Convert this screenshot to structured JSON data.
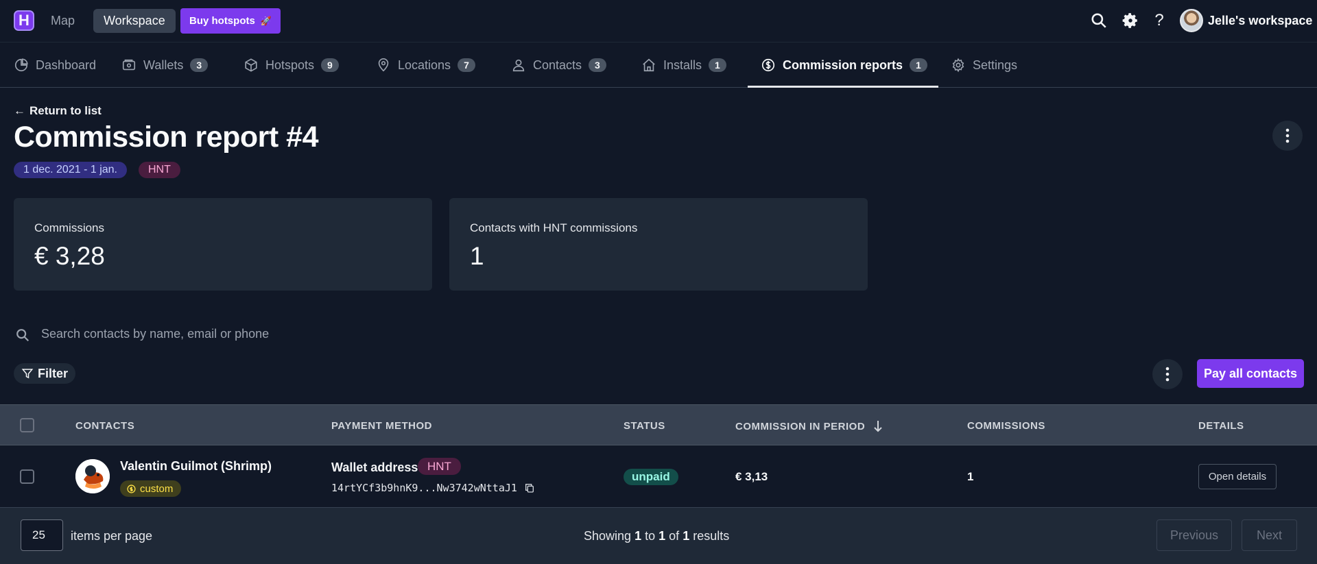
{
  "topbar": {
    "logo_letter": "H",
    "nav_map": "Map",
    "nav_workspace": "Workspace",
    "buy_label": "Buy hotspots",
    "buy_icon": "🚀",
    "icons": [
      "search-icon",
      "gear-icon",
      "help-icon"
    ],
    "help_glyph": "?",
    "workspace_name": "Jelle's workspace"
  },
  "tabs": [
    {
      "label": "Dashboard",
      "icon": "pie-chart-icon"
    },
    {
      "label": "Wallets",
      "badge": "3",
      "icon": "wallet-icon"
    },
    {
      "label": "Hotspots",
      "badge": "9",
      "icon": "cube-icon"
    },
    {
      "label": "Locations",
      "badge": "7",
      "icon": "map-pin-icon"
    },
    {
      "label": "Contacts",
      "badge": "3",
      "icon": "user-icon"
    },
    {
      "label": "Installs",
      "badge": "1",
      "icon": "home-icon"
    },
    {
      "label": "Commission reports",
      "badge": "1",
      "icon": "dollar-circle-icon",
      "active": true
    },
    {
      "label": "Settings",
      "icon": "gear-icon"
    }
  ],
  "header": {
    "return_label": "Return to list",
    "title": "Commission report #4",
    "period": "1 dec. 2021 - 1 jan.",
    "currency": "HNT"
  },
  "stats": [
    {
      "label": "Commissions",
      "value": "€ 3,28"
    },
    {
      "label": "Contacts with HNT commissions",
      "value": "1"
    }
  ],
  "search": {
    "placeholder": "Search contacts by name, email or phone"
  },
  "toolbar": {
    "filter_label": "Filter",
    "pay_all_label": "Pay all contacts"
  },
  "table": {
    "columns": [
      "CONTACTS",
      "PAYMENT METHOD",
      "STATUS",
      "COMMISSION IN PERIOD",
      "COMMISSIONS",
      "DETAILS"
    ],
    "sort_column": "COMMISSION IN PERIOD",
    "sort_direction": "desc",
    "rows": [
      {
        "name": "Valentin Guilmot (Shrimp)",
        "tag": "custom",
        "payment_method": "Wallet address",
        "payment_currency": "HNT",
        "wallet": "14rtYCf3b9hnK9...Nw3742wNttaJ1",
        "status": "unpaid",
        "commission": "€ 3,13",
        "commissions": "1",
        "details_label": "Open details"
      }
    ]
  },
  "pagination": {
    "per_page": "25",
    "per_page_label": "items per page",
    "showing_prefix": "Showing",
    "from": "1",
    "to_word": "to",
    "to": "1",
    "of_word": "of",
    "total": "1",
    "results_word": "results",
    "previous": "Previous",
    "next": "Next"
  },
  "colors": {
    "accent": "#7c3aed",
    "background": "#111827",
    "surface": "#1f2937"
  }
}
